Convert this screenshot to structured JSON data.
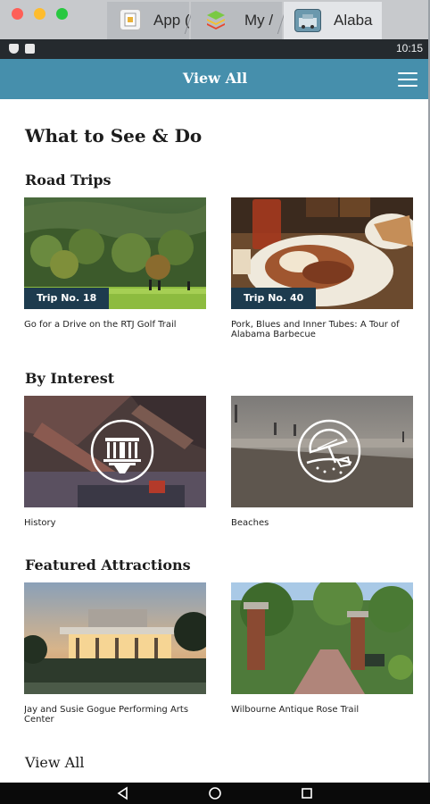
{
  "window": {
    "tabs": [
      {
        "label": "App (",
        "icon": "app-store-icon"
      },
      {
        "label": "My /",
        "icon": "bluestacks-icon"
      },
      {
        "label": "Alaba",
        "icon": "alabama-app-icon"
      }
    ]
  },
  "status_bar": {
    "time": "10:15"
  },
  "app_bar": {
    "title": "View All",
    "menu_icon": "hamburger-menu-icon"
  },
  "main": {
    "page_title": "What to See & Do",
    "sections": {
      "road_trips": {
        "title": "Road Trips",
        "cards": [
          {
            "badge": "Trip No. 18",
            "caption": "Go for a Drive on the RTJ Golf Trail"
          },
          {
            "badge": "Trip No. 40",
            "caption": "Pork, Blues and Inner Tubes: A Tour of",
            "caption_line2": "Alabama Barbecue"
          }
        ]
      },
      "by_interest": {
        "title": "By Interest",
        "cards": [
          {
            "caption": "History",
            "icon": "monument-building-icon"
          },
          {
            "caption": "Beaches",
            "icon": "beach-umbrella-icon"
          }
        ]
      },
      "featured_attractions": {
        "title": "Featured Attractions",
        "cards": [
          {
            "caption": "Jay and Susie Gogue Performing Arts",
            "caption_line2": "Center"
          },
          {
            "caption": "Wilbourne Antique Rose Trail"
          }
        ]
      }
    },
    "view_all": "View All"
  },
  "colors": {
    "app_bar": "#468fac",
    "badge": "#1d3b4e",
    "status_bar": "#252a2e"
  }
}
